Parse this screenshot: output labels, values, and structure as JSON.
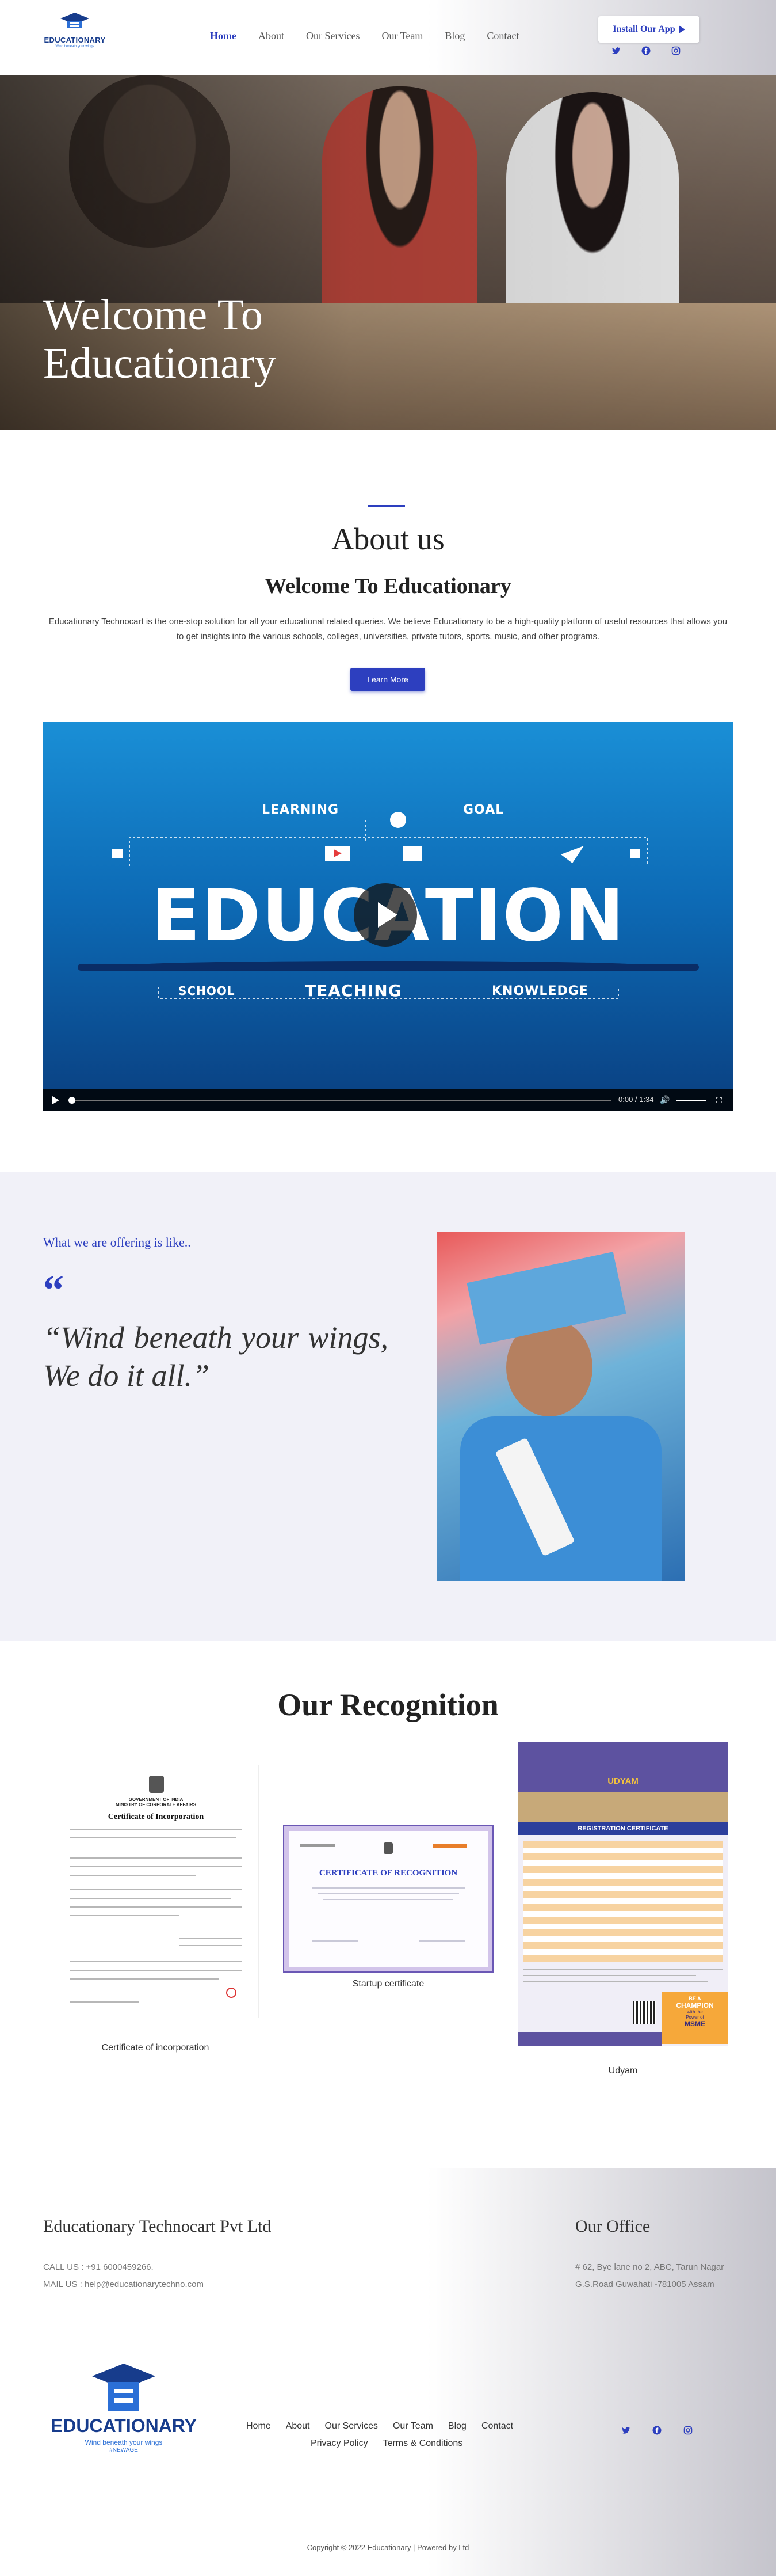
{
  "brand": {
    "name": "EDUCATIONARY",
    "tagline": "Wind beneath your wings",
    "hashtag": "#NEWAGE",
    "accent_color": "#2d3fbf"
  },
  "nav": {
    "items": [
      "Home",
      "About",
      "Our Services",
      "Our Team",
      "Blog",
      "Contact"
    ],
    "active": "Home"
  },
  "header": {
    "install_label": "Install Our App",
    "social": [
      "twitter-icon",
      "facebook-icon",
      "instagram-icon"
    ]
  },
  "hero": {
    "title_line1": "Welcome To",
    "title_line2": "Educationary"
  },
  "about": {
    "title": "About us",
    "subtitle": "Welcome To Educationary",
    "text": "Educationary Technocart is the one-stop solution for all your educational related queries. We believe Educationary to be a high-quality platform of useful resources that allows you to get insights into the various schools, colleges, universities, private tutors, sports, music, and other programs.",
    "button_label": "Learn More"
  },
  "video": {
    "words": {
      "learning": "LEARNING",
      "goal": "GOAL",
      "education": "EDUCATION",
      "school": "SCHOOL",
      "teaching": "TEACHING",
      "knowledge": "KNOWLEDGE"
    },
    "time": "0:00 / 1:34",
    "progress": 0
  },
  "offering": {
    "kicker": "What we are offering is like..",
    "quote": "“Wind beneath your wings, We do it all.”"
  },
  "recognition": {
    "title": "Our Recognition",
    "certificates": [
      {
        "caption": "Certificate of incorporation",
        "heading": "Certificate of Incorporation",
        "subheading": "GOVERNMENT OF INDIA\nMINISTRY OF CORPORATE AFFAIRS"
      },
      {
        "caption": "Startup certificate",
        "heading": "CERTIFICATE OF RECOGNITION",
        "subheading": ""
      },
      {
        "caption": "Udyam",
        "heading": "UDYAM",
        "subheading": "REGISTRATION CERTIFICATE",
        "badge_line1": "BE A",
        "badge_line2": "CHAMPION",
        "badge_line3": "with the",
        "badge_line4": "Power of",
        "badge_line5": "MSME"
      }
    ]
  },
  "footer": {
    "company": "Educationary Technocart Pvt Ltd",
    "call": "CALL US : +91 6000459266.",
    "mail": "MAIL US : help@educationarytechno.com",
    "office_title": "Our Office",
    "address_line1": "# 62, Bye lane no 2, ABC, Tarun Nagar",
    "address_line2": "G.S.Road Guwahati -781005 Assam",
    "nav_row1": [
      "Home",
      "About",
      "Our Services",
      "Our Team",
      "Blog",
      "Contact"
    ],
    "nav_row2": [
      "Privacy Policy",
      "Terms & Conditions"
    ],
    "copyright": "Copyright © 2022 Educationary | Powered by Ltd"
  }
}
